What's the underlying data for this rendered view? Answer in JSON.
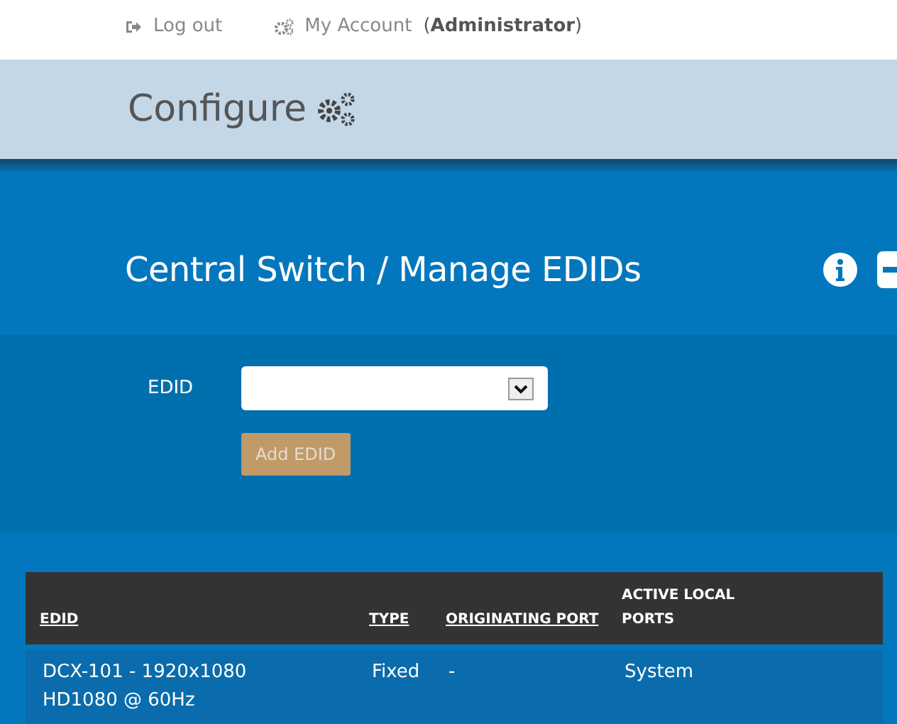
{
  "top_links": [
    {
      "kind": "logout",
      "label": "Log out"
    },
    {
      "kind": "account",
      "label": "My Account",
      "role": "(**Administrator**)"
    }
  ],
  "header": {
    "title": "Configure"
  },
  "panel": {
    "title": "Central Switch / Manage EDIDs"
  },
  "form": {
    "label": "EDID",
    "add_button": {
      "label": "Add EDID",
      "disabled": true
    }
  },
  "table": {
    "columns": [
      {
        "label": "EDID",
        "sortable": true
      },
      {
        "label": "TYPE",
        "sortable": true
      },
      {
        "label": "ORIGINATING PORT",
        "sortable": true
      },
      {
        "label": "ACTIVE LOCAL PORTS",
        "sortable": false
      }
    ],
    "rows": [
      [
        "DCX-101 - 1920x1080 HD1080 @ 60Hz",
        "Fixed",
        "-",
        "System"
      ]
    ]
  }
}
